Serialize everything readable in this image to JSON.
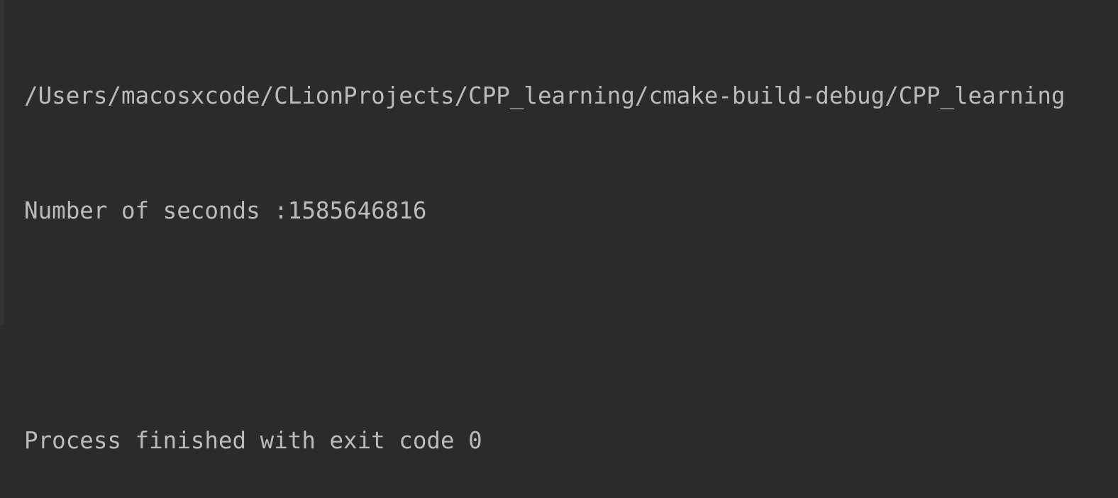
{
  "console": {
    "lines": [
      "/Users/macosxcode/CLionProjects/CPP_learning/cmake-build-debug/CPP_learning",
      "Number of seconds :1585646816",
      "",
      "Process finished with exit code 0"
    ]
  },
  "colors": {
    "background": "#2b2b2b",
    "text": "#bbbbbb"
  }
}
